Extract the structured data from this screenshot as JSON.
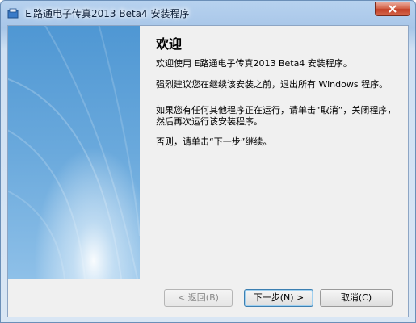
{
  "window": {
    "title": "Ｅ路通电子传真2013 Beta4 安装程序"
  },
  "main": {
    "heading": "欢迎",
    "intro": "欢迎使用 E路通电子传真2013 Beta4 安装程序。",
    "recommend": "强烈建议您在继续该安装之前，退出所有 Windows 程序。",
    "cancel_hint": "如果您有任何其他程序正在运行，请单击“取消”，关闭程序，然后再次运行该安装程序。",
    "continue_hint": "否则，请单击“下一步”继续。"
  },
  "footer": {
    "back_label": "< 返回(B)",
    "next_label": "下一步(N) >",
    "cancel_label": "取消(C)"
  },
  "colors": {
    "side_panel": "#5b9fd6",
    "title_bar": "#b7d2ef",
    "close_button": "#c8442b"
  },
  "icons": {
    "app": "setup-app-icon",
    "close": "close-icon"
  }
}
